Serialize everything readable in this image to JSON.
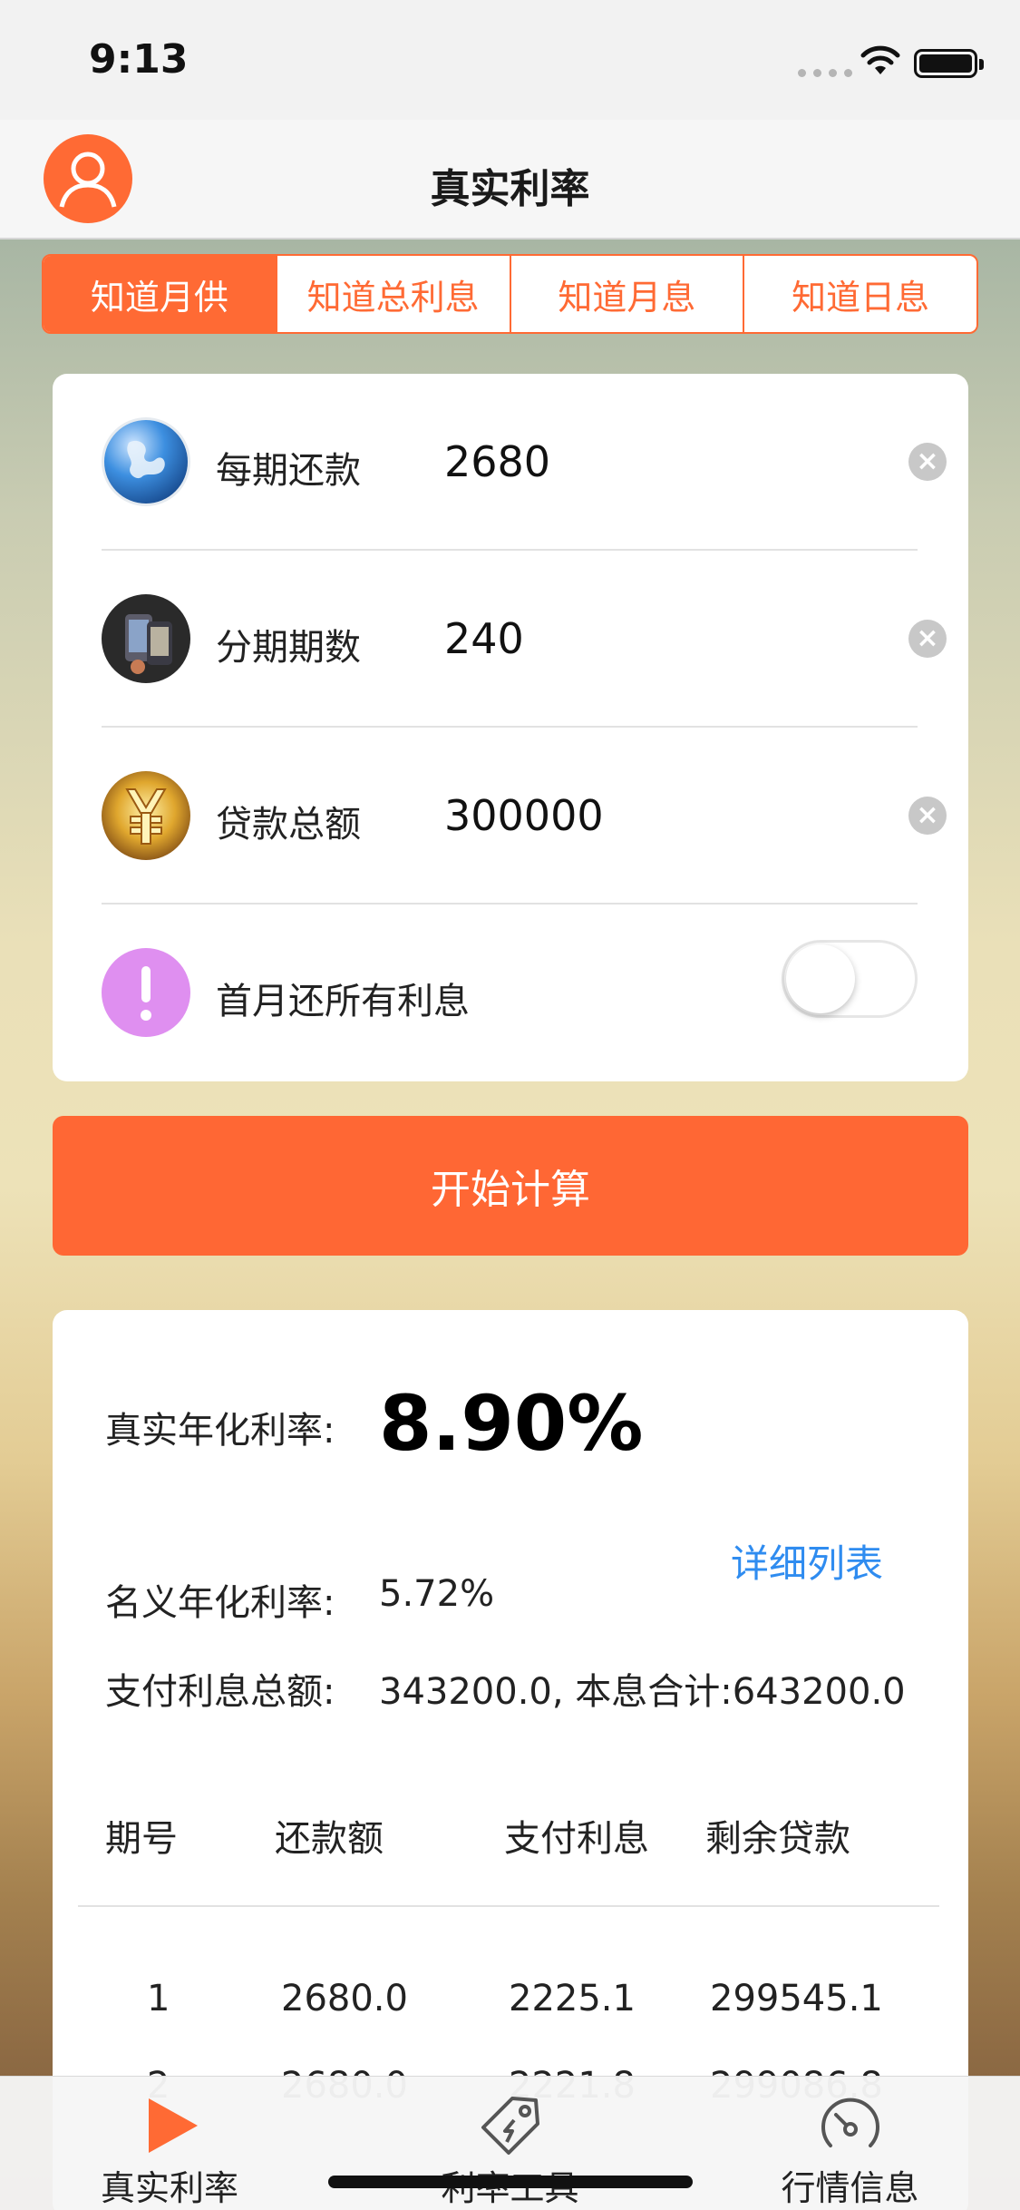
{
  "status_bar": {
    "time": "9:13"
  },
  "nav": {
    "title": "真实利率",
    "avatar_icon": "user-avatar-icon"
  },
  "segmented": {
    "tabs": [
      "知道月供",
      "知道总利息",
      "知道月息",
      "知道日息"
    ],
    "active_index": 0
  },
  "form": {
    "payment": {
      "label": "每期还款",
      "value": "2680",
      "icon": "globe-icon"
    },
    "periods": {
      "label": "分期期数",
      "value": "240",
      "icon": "phone-icon"
    },
    "loan": {
      "label": "贷款总额",
      "value": "300000",
      "icon": "yuan-icon"
    },
    "first_month": {
      "label": "首月还所有利息",
      "toggle_on": false,
      "icon": "exclamation-icon"
    }
  },
  "calc_button": {
    "label": "开始计算"
  },
  "result": {
    "real_rate_label": "真实年化利率:",
    "real_rate_value": "8.90%",
    "detail_link": "详细列表",
    "nominal_rate_label": "名义年化利率:",
    "nominal_rate_value": "5.72%",
    "interest_label": "支付利息总额:",
    "interest_value": "343200.0, 本息合计:643200.0"
  },
  "table": {
    "headers": [
      "期号",
      "还款额",
      "支付利息",
      "剩余贷款"
    ],
    "rows": [
      [
        "1",
        "2680.0",
        "2225.1",
        "299545.1"
      ],
      [
        "2",
        "2680.0",
        "2221.8",
        "299086.8"
      ]
    ]
  },
  "tab_bar": {
    "tabs": [
      {
        "label": "真实利率",
        "icon": "play-icon",
        "active": true
      },
      {
        "label": "利率工具",
        "icon": "tag-icon",
        "active": false
      },
      {
        "label": "行情信息",
        "icon": "gauge-icon",
        "active": false
      }
    ]
  },
  "colors": {
    "accent": "#ff6a34",
    "link": "#2f8cf0"
  }
}
